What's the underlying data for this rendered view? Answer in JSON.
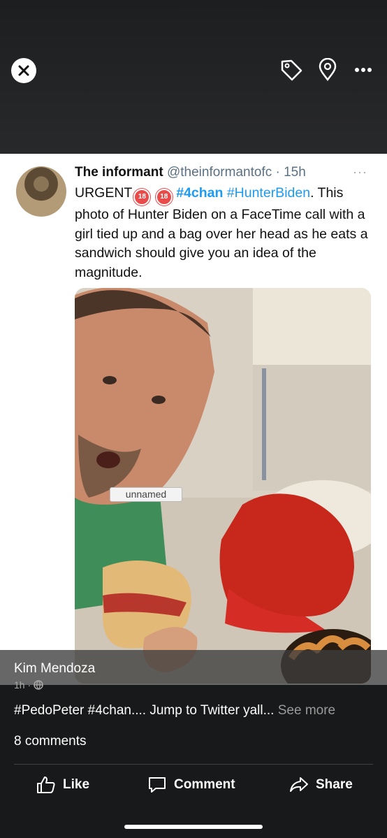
{
  "toolbar": {
    "close_icon": "close-icon",
    "tag_icon": "tag-icon",
    "location_icon": "location-pin-icon",
    "more_icon": "more-icon"
  },
  "tweet": {
    "author_name": "The informant",
    "handle_time": "@theinformantofc · 15h",
    "more": "···",
    "text_prefix": "URGENT",
    "badge": "18",
    "hashtag1": "#4chan",
    "hashtag2": "#HunterBiden",
    "text_body": ". This photo of Hunter Biden on a FaceTime call with a girl tied up and a bag over her head as he eats a sandwich should give you an idea of the magnitude.",
    "image_label": "unnamed"
  },
  "post": {
    "author": "Kim Mendoza",
    "meta": "1h ·",
    "text": "#PedoPeter #4chan.... Jump to Twitter yall...",
    "see_more": "See more",
    "comments": "8 comments"
  },
  "actions": {
    "like": "Like",
    "comment": "Comment",
    "share": "Share"
  },
  "colors": {
    "hashtag": "#1d9bf0",
    "background": "#18191a"
  }
}
